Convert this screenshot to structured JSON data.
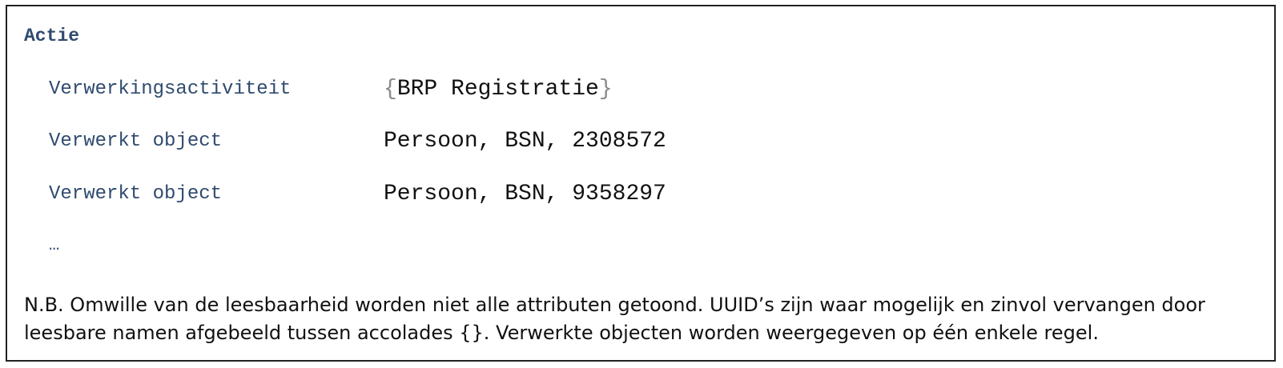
{
  "heading": "Actie",
  "rows": [
    {
      "label": "Verwerkingsactiviteit",
      "brace_open": "{",
      "value": "BRP Registratie",
      "brace_close": "}"
    },
    {
      "label": "Verwerkt object",
      "value": "Persoon, BSN, 2308572"
    },
    {
      "label": "Verwerkt object",
      "value": "Persoon, BSN, 9358297"
    }
  ],
  "ellipsis": "…",
  "note": {
    "line1": "N.B. Omwille van de leesbaarheid worden niet alle attributen getoond. UUID’s zijn waar mogelijk en zinvol vervangen door",
    "line2": "leesbare namen afgebeeld tussen accolades {}. Verwerkte objecten worden weergegeven op één enkele regel."
  },
  "colors": {
    "label_blue": "#2f4a6f",
    "value_black": "#111111",
    "brace_gray": "#8a8a8a",
    "border": "#222222"
  }
}
